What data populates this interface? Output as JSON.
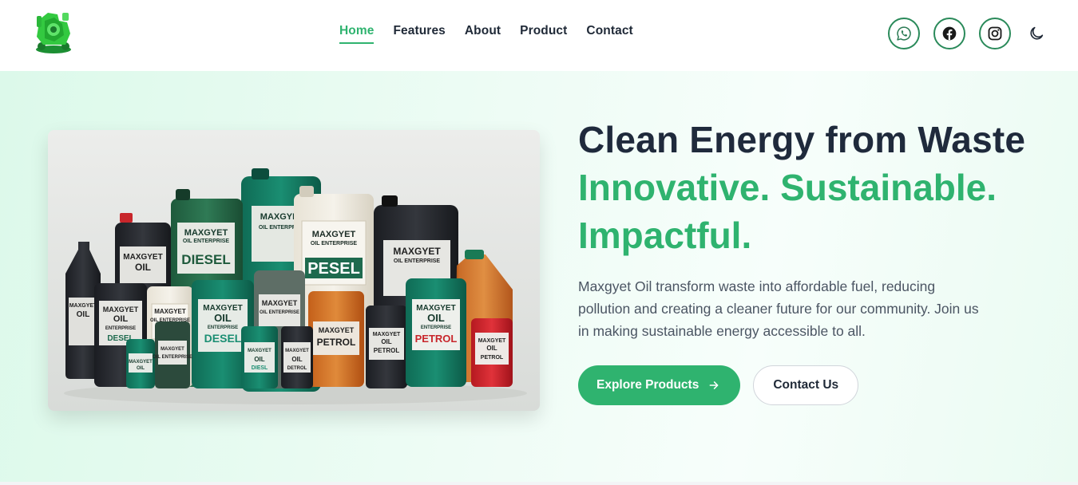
{
  "brand": {
    "logo_icon": "maxgyet-logo-icon"
  },
  "nav": {
    "items": [
      {
        "label": "Home",
        "active": true
      },
      {
        "label": "Features",
        "active": false
      },
      {
        "label": "About",
        "active": false
      },
      {
        "label": "Product",
        "active": false
      },
      {
        "label": "Contact",
        "active": false
      }
    ]
  },
  "socials": {
    "icons": [
      "whatsapp-icon",
      "facebook-icon",
      "instagram-icon"
    ],
    "theme_toggle_icon": "moon-icon"
  },
  "hero": {
    "title": "Clean Energy from Waste",
    "subtitle_line1": "Innovative. Sustainable.",
    "subtitle_line2": "Impactful.",
    "description": "Maxgyet Oil transform waste into affordable fuel, reducing pollution and creating a cleaner future for our community. Join us in making sustainable energy accessible to all.",
    "primary_button": "Explore Products",
    "secondary_button": "Contact Us"
  },
  "product_image": {
    "labels": {
      "brand": "MAXGYET",
      "oil": "OIL",
      "enterprise": "ENTERPRISE",
      "oil_enterprise": "OIL ENTERPRISE",
      "diesel": "DIESEL",
      "pesel": "PESEL",
      "petrol": "PETROL",
      "desel": "DESEL",
      "diesl": "DIESL",
      "detrol": "DETROL"
    }
  },
  "colors": {
    "accent": "#2fb36f",
    "title": "#1f2a3c",
    "social_border": "#2a8a5a"
  }
}
